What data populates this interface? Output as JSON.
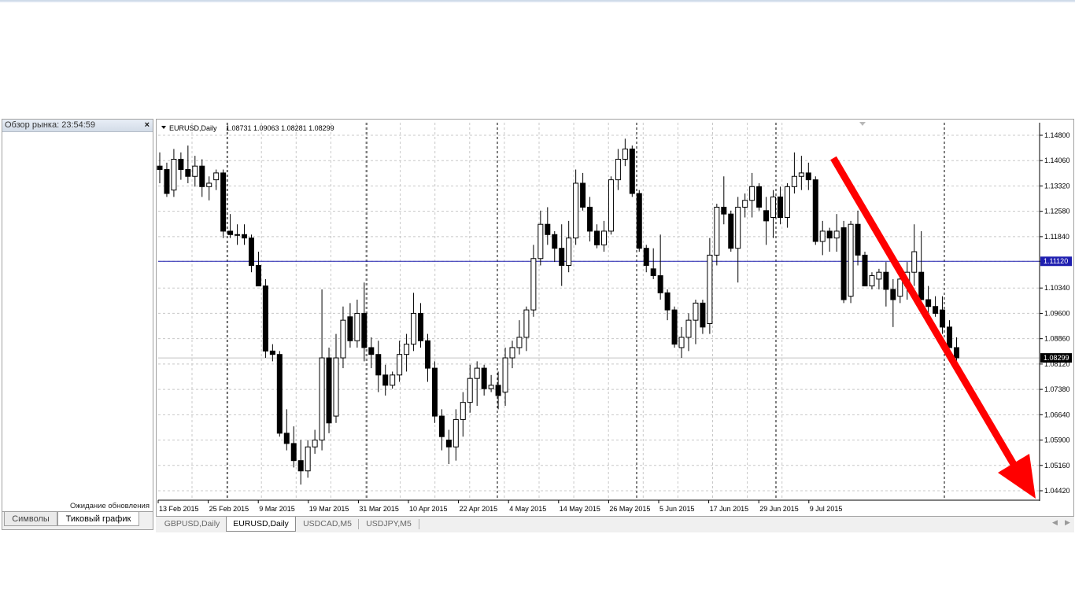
{
  "market_watch": {
    "title": "Обзор рынка: 23:54:59",
    "close_icon": "close-icon",
    "status": "Ожидание обновления",
    "tabs": [
      "Символы",
      "Тиковый график"
    ],
    "active_tab": 1
  },
  "chart": {
    "header_symbol": "EURUSD,Daily",
    "header_prices": "1.08731 1.09063 1.08281 1.08299",
    "colors": {
      "grid": "#c0c0c0",
      "hline": "#1f1fb0",
      "arrow": "#ff0000",
      "bid_line": "#c0c0c0"
    }
  },
  "chart_data": {
    "type": "candlestick",
    "symbol": "EURUSD",
    "timeframe": "Daily",
    "y_ticks": [
      "1.14800",
      "1.14060",
      "1.13320",
      "1.12580",
      "1.11840",
      "1.11120",
      "1.10340",
      "1.09600",
      "1.08860",
      "1.08120",
      "1.07380",
      "1.06640",
      "1.05900",
      "1.05160",
      "1.04420"
    ],
    "ylim": [
      1.0442,
      1.148
    ],
    "x_ticks": [
      "13 Feb 2015",
      "25 Feb 2015",
      "9 Mar 2015",
      "19 Mar 2015",
      "31 Mar 2015",
      "10 Apr 2015",
      "22 Apr 2015",
      "4 May 2015",
      "14 May 2015",
      "26 May 2015",
      "5 Jun 2015",
      "17 Jun 2015",
      "29 Jun 2015",
      "9 Jul 2015"
    ],
    "horizontal_line": {
      "label": "1.11120",
      "value": 1.1112
    },
    "current_price": {
      "label": "1.08299",
      "value": 1.08299
    },
    "grid": true,
    "candles": [
      [
        1.139,
        1.143,
        1.134,
        1.138
      ],
      [
        1.138,
        1.14,
        1.13,
        1.131
      ],
      [
        1.132,
        1.144,
        1.13,
        1.141
      ],
      [
        1.141,
        1.143,
        1.135,
        1.138
      ],
      [
        1.138,
        1.145,
        1.134,
        1.136
      ],
      [
        1.136,
        1.142,
        1.133,
        1.139
      ],
      [
        1.139,
        1.141,
        1.13,
        1.133
      ],
      [
        1.133,
        1.136,
        1.129,
        1.134
      ],
      [
        1.135,
        1.138,
        1.132,
        1.137
      ],
      [
        1.137,
        1.138,
        1.118,
        1.12
      ],
      [
        1.12,
        1.125,
        1.118,
        1.119
      ],
      [
        1.119,
        1.122,
        1.116,
        1.119
      ],
      [
        1.119,
        1.122,
        1.116,
        1.118
      ],
      [
        1.118,
        1.119,
        1.108,
        1.11
      ],
      [
        1.11,
        1.114,
        1.106,
        1.104
      ],
      [
        1.104,
        1.106,
        1.083,
        1.085
      ],
      [
        1.085,
        1.087,
        1.082,
        1.084
      ],
      [
        1.084,
        1.085,
        1.06,
        1.061
      ],
      [
        1.061,
        1.068,
        1.056,
        1.058
      ],
      [
        1.058,
        1.063,
        1.051,
        1.053
      ],
      [
        1.053,
        1.059,
        1.046,
        1.05
      ],
      [
        1.05,
        1.059,
        1.048,
        1.057
      ],
      [
        1.057,
        1.062,
        1.055,
        1.059
      ],
      [
        1.059,
        1.103,
        1.056,
        1.083
      ],
      [
        1.083,
        1.086,
        1.061,
        1.064
      ],
      [
        1.066,
        1.09,
        1.064,
        1.083
      ],
      [
        1.083,
        1.098,
        1.08,
        1.094
      ],
      [
        1.095,
        1.099,
        1.086,
        1.088
      ],
      [
        1.088,
        1.1,
        1.086,
        1.096
      ],
      [
        1.096,
        1.105,
        1.082,
        1.086
      ],
      [
        1.086,
        1.089,
        1.08,
        1.084
      ],
      [
        1.084,
        1.088,
        1.073,
        1.078
      ],
      [
        1.078,
        1.081,
        1.072,
        1.075
      ],
      [
        1.075,
        1.079,
        1.074,
        1.078
      ],
      [
        1.078,
        1.088,
        1.076,
        1.084
      ],
      [
        1.084,
        1.09,
        1.079,
        1.087
      ],
      [
        1.087,
        1.102,
        1.085,
        1.096
      ],
      [
        1.096,
        1.099,
        1.086,
        1.088
      ],
      [
        1.088,
        1.09,
        1.076,
        1.08
      ],
      [
        1.08,
        1.082,
        1.064,
        1.066
      ],
      [
        1.066,
        1.068,
        1.056,
        1.06
      ],
      [
        1.059,
        1.062,
        1.052,
        1.057
      ],
      [
        1.057,
        1.068,
        1.053,
        1.065
      ],
      [
        1.065,
        1.073,
        1.06,
        1.07
      ],
      [
        1.07,
        1.081,
        1.067,
        1.077
      ],
      [
        1.077,
        1.082,
        1.069,
        1.08
      ],
      [
        1.08,
        1.081,
        1.072,
        1.074
      ],
      [
        1.074,
        1.078,
        1.073,
        1.075
      ],
      [
        1.075,
        1.079,
        1.068,
        1.072
      ],
      [
        1.073,
        1.086,
        1.069,
        1.083
      ],
      [
        1.083,
        1.088,
        1.08,
        1.086
      ],
      [
        1.086,
        1.094,
        1.084,
        1.089
      ],
      [
        1.089,
        1.098,
        1.085,
        1.097
      ],
      [
        1.097,
        1.116,
        1.095,
        1.112
      ],
      [
        1.112,
        1.126,
        1.11,
        1.122
      ],
      [
        1.122,
        1.127,
        1.116,
        1.119
      ],
      [
        1.119,
        1.12,
        1.111,
        1.115
      ],
      [
        1.115,
        1.122,
        1.104,
        1.11
      ],
      [
        1.11,
        1.123,
        1.108,
        1.118
      ],
      [
        1.118,
        1.138,
        1.116,
        1.134
      ],
      [
        1.134,
        1.137,
        1.126,
        1.127
      ],
      [
        1.127,
        1.13,
        1.117,
        1.12
      ],
      [
        1.12,
        1.122,
        1.115,
        1.116
      ],
      [
        1.116,
        1.123,
        1.114,
        1.12
      ],
      [
        1.12,
        1.136,
        1.119,
        1.135
      ],
      [
        1.135,
        1.144,
        1.132,
        1.141
      ],
      [
        1.141,
        1.147,
        1.139,
        1.144
      ],
      [
        1.144,
        1.145,
        1.13,
        1.131
      ],
      [
        1.131,
        1.132,
        1.114,
        1.115
      ],
      [
        1.115,
        1.116,
        1.108,
        1.11
      ],
      [
        1.109,
        1.115,
        1.106,
        1.107
      ],
      [
        1.107,
        1.119,
        1.1,
        1.102
      ],
      [
        1.102,
        1.103,
        1.094,
        1.097
      ],
      [
        1.097,
        1.098,
        1.086,
        1.087
      ],
      [
        1.086,
        1.092,
        1.083,
        1.089
      ],
      [
        1.089,
        1.096,
        1.085,
        1.094
      ],
      [
        1.094,
        1.1,
        1.087,
        1.099
      ],
      [
        1.099,
        1.1,
        1.09,
        1.092
      ],
      [
        1.093,
        1.118,
        1.09,
        1.113
      ],
      [
        1.113,
        1.128,
        1.11,
        1.127
      ],
      [
        1.127,
        1.136,
        1.122,
        1.125
      ],
      [
        1.125,
        1.126,
        1.114,
        1.115
      ],
      [
        1.115,
        1.13,
        1.105,
        1.127
      ],
      [
        1.127,
        1.131,
        1.124,
        1.129
      ],
      [
        1.129,
        1.137,
        1.124,
        1.133
      ],
      [
        1.133,
        1.134,
        1.126,
        1.127
      ],
      [
        1.126,
        1.13,
        1.116,
        1.123
      ],
      [
        1.124,
        1.132,
        1.118,
        1.13
      ],
      [
        1.13,
        1.133,
        1.122,
        1.124
      ],
      [
        1.124,
        1.134,
        1.121,
        1.133
      ],
      [
        1.133,
        1.143,
        1.131,
        1.136
      ],
      [
        1.136,
        1.142,
        1.132,
        1.137
      ],
      [
        1.137,
        1.14,
        1.132,
        1.135
      ],
      [
        1.135,
        1.136,
        1.116,
        1.117
      ],
      [
        1.117,
        1.123,
        1.113,
        1.12
      ],
      [
        1.12,
        1.121,
        1.114,
        1.118
      ],
      [
        1.118,
        1.125,
        1.114,
        1.12
      ],
      [
        1.121,
        1.123,
        1.099,
        1.1
      ],
      [
        1.101,
        1.123,
        1.099,
        1.122
      ],
      [
        1.122,
        1.126,
        1.11,
        1.113
      ],
      [
        1.113,
        1.114,
        1.104,
        1.104
      ],
      [
        1.104,
        1.108,
        1.103,
        1.107
      ],
      [
        1.106,
        1.109,
        1.103,
        1.108
      ],
      [
        1.108,
        1.111,
        1.098,
        1.103
      ],
      [
        1.103,
        1.106,
        1.092,
        1.1
      ],
      [
        1.101,
        1.108,
        1.099,
        1.106
      ],
      [
        1.104,
        1.111,
        1.1,
        1.108
      ],
      [
        1.108,
        1.122,
        1.104,
        1.114
      ],
      [
        1.108,
        1.12,
        1.1,
        1.1
      ],
      [
        1.1,
        1.104,
        1.096,
        1.098
      ],
      [
        1.098,
        1.101,
        1.095,
        1.096
      ],
      [
        1.097,
        1.101,
        1.09,
        1.092
      ],
      [
        1.092,
        1.094,
        1.086,
        1.086
      ],
      [
        1.086,
        1.089,
        1.082,
        1.083
      ]
    ]
  },
  "chart_tabs": [
    "GBPUSD,Daily",
    "EURUSD,Daily",
    "USDCAD,M5",
    "USDJPY,M5"
  ],
  "active_chart_tab": 1
}
